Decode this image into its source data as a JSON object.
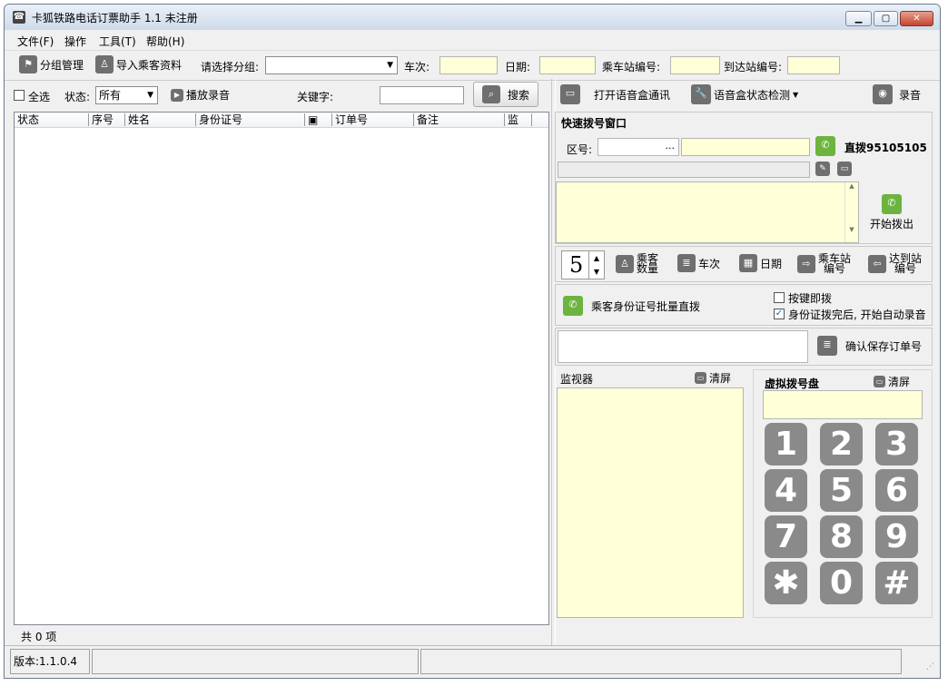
{
  "window": {
    "title": "卡狐铁路电话订票助手 1.1 未注册"
  },
  "menu": [
    "文件(F)",
    "操作",
    "工具(T)",
    "帮助(H)"
  ],
  "toolbar": {
    "group_manage": "分组管理",
    "import_passengers": "导入乘客资料",
    "select_group_label": "请选择分组:",
    "train_label": "车次:",
    "date_label": "日期:",
    "board_station_label": "乘车站编号:",
    "arrive_station_label": "到达站编号:"
  },
  "filter": {
    "select_all": "全选",
    "status_label": "状态:",
    "status_value": "所有",
    "play_recording": "播放录音",
    "keyword_label": "关键字:",
    "search_button": "搜索"
  },
  "table": {
    "columns": [
      "状态",
      "序号",
      "姓名",
      "身份证号",
      "",
      "订单号",
      "备注",
      "监"
    ],
    "rows": []
  },
  "list_count": "共 0 项",
  "statusbar": {
    "version": "版本:1.1.0.4"
  },
  "voicebox": {
    "open": "打开语音盒通讯",
    "check_status": "语音盒状态检测",
    "record": "录音"
  },
  "quick_dial": {
    "title": "快速拨号窗口",
    "area_label": "区号:",
    "area_button": "...",
    "direct_dial": "直拨95105105",
    "start_dial": "开始拨出"
  },
  "params": {
    "passenger_count": "5",
    "passenger_count_label": [
      "乘客",
      "数量"
    ],
    "train": "车次",
    "date": "日期",
    "board_station": [
      "乘车站",
      "编号"
    ],
    "arrive_station": [
      "达到站",
      "编号"
    ]
  },
  "batch": {
    "label": "乘客身份证号批量直拨",
    "press_dial": "按键即拨",
    "auto_record": "身份证拨完后, 开始自动录音",
    "press_dial_checked": false,
    "auto_record_checked": true
  },
  "save_order": {
    "button": "确认保存订单号"
  },
  "monitor": {
    "title": "监视器",
    "clear": "清屏"
  },
  "dialpad": {
    "title": "虚拟拨号盘",
    "clear": "清屏",
    "keys": [
      "1",
      "2",
      "3",
      "4",
      "5",
      "6",
      "7",
      "8",
      "9",
      "✱",
      "0",
      "#"
    ]
  },
  "colors": {
    "yellow_field": "#ffffd8",
    "green_icon": "#6db33f",
    "key_gray": "#8a8a8a"
  }
}
